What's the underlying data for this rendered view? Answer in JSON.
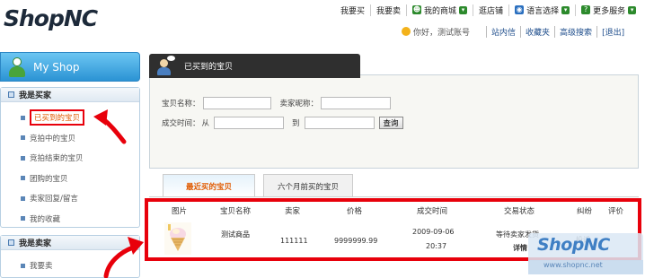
{
  "header": {
    "logo": "ShopNC",
    "topnav": [
      {
        "label": "我要买"
      },
      {
        "label": "我要卖"
      },
      {
        "label": "我的商城",
        "icon": "user-icon"
      },
      {
        "label": "逛店铺"
      },
      {
        "label": "语言选择",
        "icon": "globe-icon"
      },
      {
        "label": "更多服务",
        "icon": "help-icon"
      }
    ],
    "greeting": "你好，测试账号",
    "sublinks": [
      "站内信",
      "收藏夹",
      "高级搜索",
      "[退出]"
    ]
  },
  "sidebar": {
    "title": "My Shop",
    "buyer": {
      "heading": "我是买家",
      "items": [
        "已买到的宝贝",
        "竞拍中的宝贝",
        "竞拍结束的宝贝",
        "团购的宝贝",
        "卖家回复/留言",
        "我的收藏"
      ]
    },
    "seller": {
      "heading": "我是卖家",
      "items": [
        "我要卖"
      ]
    }
  },
  "main": {
    "tab_title": "已买到的宝贝",
    "search": {
      "item_name_label": "宝贝名称：",
      "seller_label": "卖家昵称：",
      "time_label": "成交时间：",
      "from_label": "从",
      "to_label": "到",
      "query_button": "查询"
    },
    "subtabs": [
      "最近买的宝贝",
      "六个月前买的宝贝"
    ],
    "table": {
      "headers": [
        "图片",
        "宝贝名称",
        "卖家",
        "价格",
        "成交时间",
        "交易状态",
        "纠纷",
        "评价"
      ],
      "rows": [
        {
          "name": "测试商品",
          "seller": "111111",
          "price": "9999999.99",
          "date": "2009-09-06",
          "time": "20:37",
          "status": "等待卖家发货",
          "detail": "详情",
          "dispute": "投诉"
        }
      ]
    }
  },
  "watermark": {
    "brand": "ShopNC",
    "url": "www.shopnc.net"
  },
  "colors": {
    "accent_red": "#e8000b",
    "active_orange": "#e05a00",
    "sidebar_blue": "#2b93d4"
  }
}
